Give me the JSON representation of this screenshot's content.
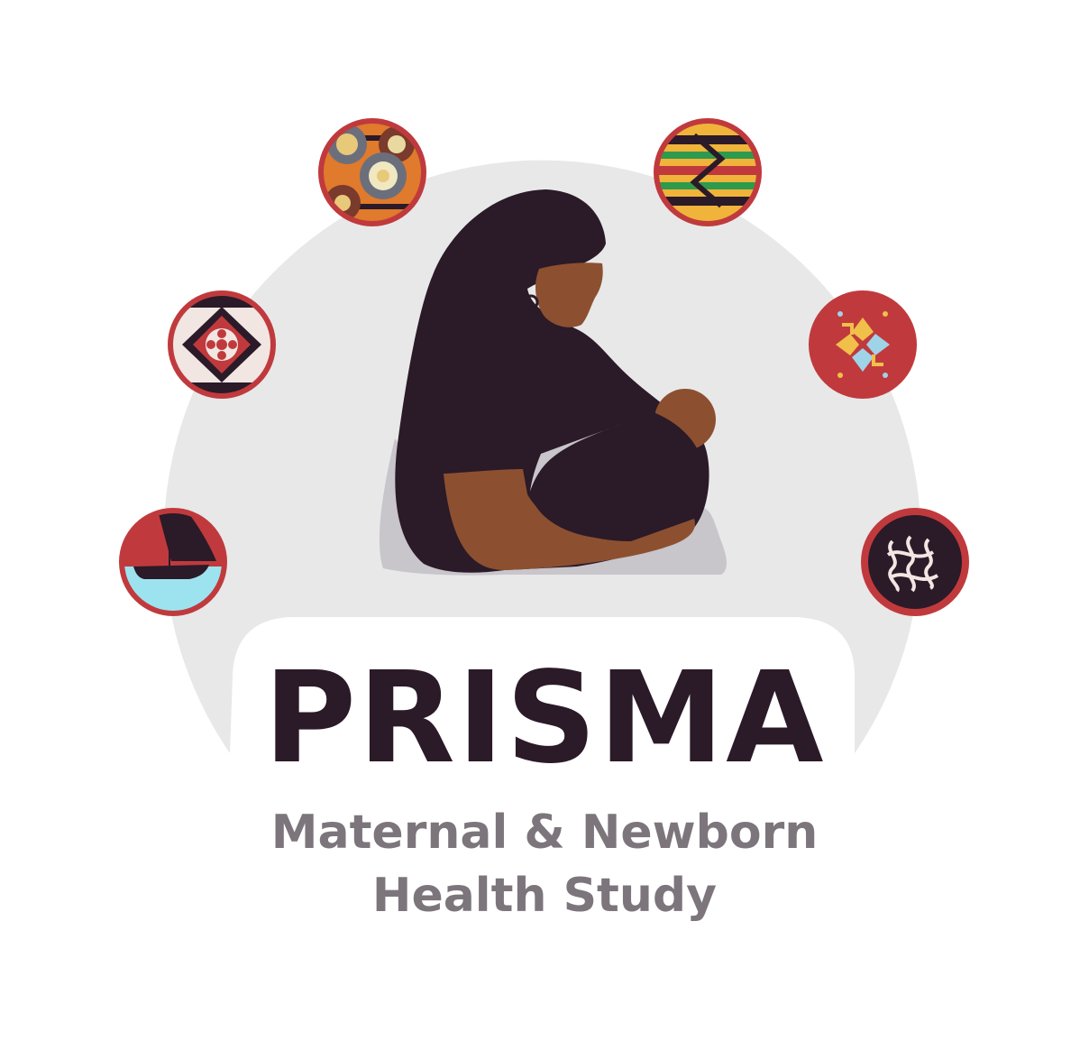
{
  "logo": {
    "title": "PRISMA",
    "subtitle_line1": "Maternal & Newborn",
    "subtitle_line2": "Health Study"
  },
  "colors": {
    "background": "#ffffff",
    "halo": "#e8e8e9",
    "cloth": "#2b1a28",
    "skin": "#8c5030",
    "cushion": "#c8c5cb",
    "badge_red": "#c03a3d",
    "title_text": "#2b1a28",
    "subtitle_text": "#7c767c"
  },
  "badges": [
    {
      "name": "dhow-boat-badge",
      "icon": "sailboat-icon"
    },
    {
      "name": "floral-tile-badge",
      "icon": "floral-pattern-icon"
    },
    {
      "name": "wax-print-circles-badge",
      "icon": "concentric-circles-icon"
    },
    {
      "name": "kente-stripes-badge",
      "icon": "kente-pattern-icon"
    },
    {
      "name": "arrow-snowflake-badge",
      "icon": "arrow-star-icon"
    },
    {
      "name": "knot-motif-badge",
      "icon": "knot-pattern-icon"
    }
  ]
}
